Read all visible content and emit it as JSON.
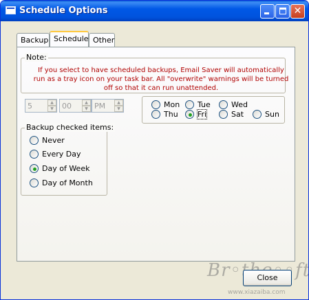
{
  "window": {
    "title": "Schedule Options",
    "minimize_glyph": "",
    "maximize_glyph": "",
    "close_glyph": "✕"
  },
  "tabs": [
    {
      "label": "Backup",
      "active": false
    },
    {
      "label": "Schedule",
      "active": true
    },
    {
      "label": "Other",
      "active": false
    }
  ],
  "note": {
    "legend": "Note:",
    "text": "If you select to have scheduled backups, Email Saver will automatically run as a tray icon on your task bar.  All \"overwrite\" warnings will be turned off so that it can run unattended.",
    "color": "#b00000"
  },
  "time": {
    "hour": "5",
    "minute": "00",
    "ampm": "PM"
  },
  "days": [
    {
      "label": "Mon",
      "checked": false
    },
    {
      "label": "Tue",
      "checked": false
    },
    {
      "label": "Wed",
      "checked": false
    },
    {
      "label": "Thu",
      "checked": false
    },
    {
      "label": "Fri",
      "checked": true
    },
    {
      "label": "Sat",
      "checked": false
    },
    {
      "label": "Sun",
      "checked": false
    }
  ],
  "backup": {
    "legend": "Backup checked items:",
    "options": [
      {
        "label": "Never",
        "checked": false
      },
      {
        "label": "Every Day",
        "checked": false
      },
      {
        "label": "Day of Week",
        "checked": true
      },
      {
        "label": "Day of Month",
        "checked": false
      }
    ]
  },
  "buttons": {
    "close": "Close"
  },
  "watermark": {
    "logo_text": "Br◦the◦◦ft",
    "url": "www.xiazaiba.com"
  }
}
